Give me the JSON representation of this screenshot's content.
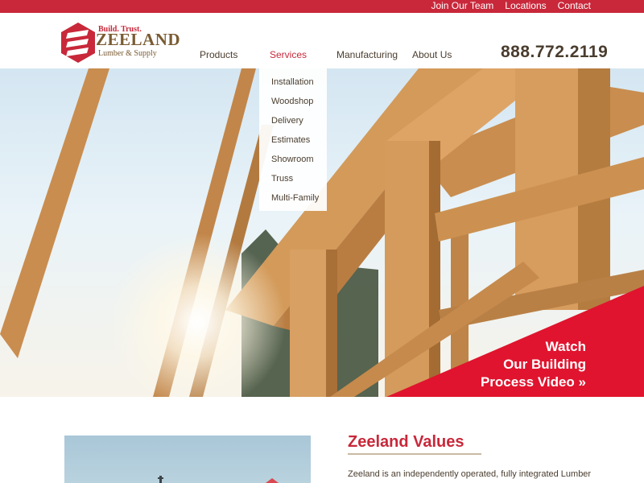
{
  "top_links": [
    "Join Our Team",
    "Locations",
    "Contact"
  ],
  "logo": {
    "tagline": "Build. Trust.",
    "name": "ZEELAND",
    "subtitle": "Lumber & Supply"
  },
  "nav": {
    "items": [
      "Products",
      "Services",
      "Manufacturing",
      "About Us"
    ],
    "active": "Services"
  },
  "phone": "888.772.2119",
  "services_menu": [
    "Installation",
    "Woodshop",
    "Delivery",
    "Estimates",
    "Showroom",
    "Truss",
    "Multi-Family"
  ],
  "cta": {
    "line1": "Watch",
    "line2": "Our Building",
    "line3": "Process Video »"
  },
  "values": {
    "title": "Zeeland Values",
    "text": "Zeeland is an independently operated, fully integrated Lumber"
  },
  "colors": {
    "brand_red": "#c8283a",
    "brand_brown": "#7a5b32",
    "text_dark": "#4a3d2e"
  }
}
